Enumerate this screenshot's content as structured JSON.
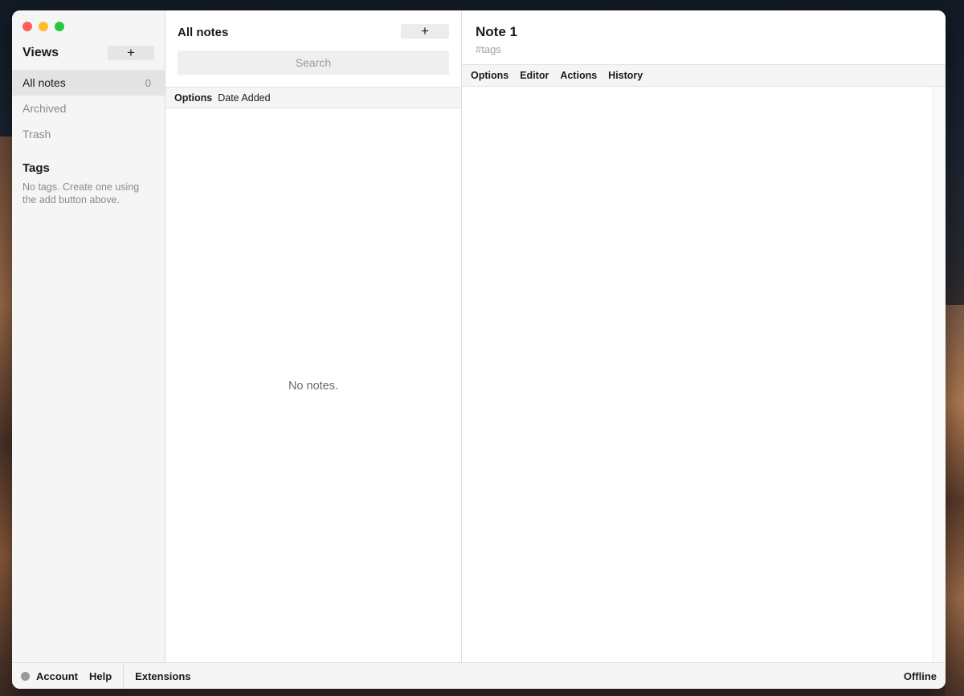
{
  "sidebar": {
    "views_title": "Views",
    "add_view_label": "+",
    "items": [
      {
        "label": "All notes",
        "count": "0"
      },
      {
        "label": "Archived"
      },
      {
        "label": "Trash"
      }
    ],
    "tags_title": "Tags",
    "tags_empty": "No tags. Create one using the add button above."
  },
  "notes": {
    "title": "All notes",
    "add_label": "+",
    "search_placeholder": "Search",
    "options_label": "Options",
    "sort_label": "Date Added",
    "empty_text": "No notes."
  },
  "editor": {
    "note_title": "Note 1",
    "tags_placeholder": "#tags",
    "menu": [
      "Options",
      "Editor",
      "Actions",
      "History"
    ]
  },
  "footer": {
    "account": "Account",
    "help": "Help",
    "extensions": "Extensions",
    "status": "Offline"
  },
  "colors": {
    "traffic_red": "#fe5f57",
    "traffic_yellow": "#febc2e",
    "traffic_green": "#28c840"
  }
}
